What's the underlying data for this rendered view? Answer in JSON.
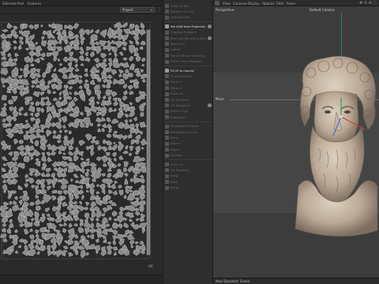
{
  "uv_editor": {
    "menu": [
      "Selection",
      "Peel",
      "Features"
    ],
    "projection_select": "Project",
    "uv_label": "UV"
  },
  "tools": {
    "items": [
      {
        "label": "Cube UV Tool",
        "active": false
      },
      {
        "label": "Reverse UV Tool",
        "active": false
      },
      {
        "label": "Optimize UVs",
        "active": false
      },
      {
        "label": "Set UVW from Projection",
        "active": true,
        "help": true
      },
      {
        "label": "Ungroup Polygons",
        "active": false
      },
      {
        "label": "Pack UVs (Bounding Box)",
        "active": false,
        "help": true
      },
      {
        "label": "Relax UVs",
        "active": false
      },
      {
        "label": "Unitize",
        "active": false
      },
      {
        "label": "Terrace Mirror Flattening",
        "active": false
      },
      {
        "label": "Flatten Polys Mapping",
        "active": false
      },
      {
        "label": "Fit UV to Canvas",
        "active": true
      },
      {
        "label": "Fit Active Scale",
        "active": false
      },
      {
        "label": "Mirror U",
        "active": false
      },
      {
        "label": "Mirror V",
        "active": false
      },
      {
        "label": "Scale UV",
        "active": false
      },
      {
        "label": "UV Transform",
        "active": false
      },
      {
        "label": "UV Straighten",
        "active": false,
        "help": true
      },
      {
        "label": "Align to Grid",
        "active": false
      },
      {
        "label": "Straighten",
        "active": false
      },
      {
        "label": "Rectangle to Square",
        "active": false
      },
      {
        "label": "Rectangle to Circle",
        "active": false
      },
      {
        "label": "Mirror",
        "active": false
      },
      {
        "label": "Align U",
        "active": false
      },
      {
        "label": "Align V",
        "active": false
      },
      {
        "label": "Equalize",
        "active": false
      },
      {
        "label": "Scale UV",
        "active": false
      },
      {
        "label": "Pin Selection",
        "active": false
      },
      {
        "label": "Snap",
        "active": false
      },
      {
        "label": "Weld",
        "active": false
      },
      {
        "label": "Merge",
        "active": false
      }
    ]
  },
  "viewport": {
    "menu": [
      "View",
      "Cameras",
      "Display",
      "Options",
      "Filter",
      "Panel"
    ],
    "camera_mode": "Perspective",
    "camera_name": "Default Camera",
    "tool_hint": "Move",
    "status": "New Standard: Scene"
  },
  "colors": {
    "uv_island_fill": "#8a8a8a",
    "uv_island_stroke": "#e8e8e8",
    "bust_base": "#c9b8a4",
    "axis_y": "#2aa84a",
    "axis_x": "#d23b3b",
    "axis_z": "#3b6fd2"
  }
}
